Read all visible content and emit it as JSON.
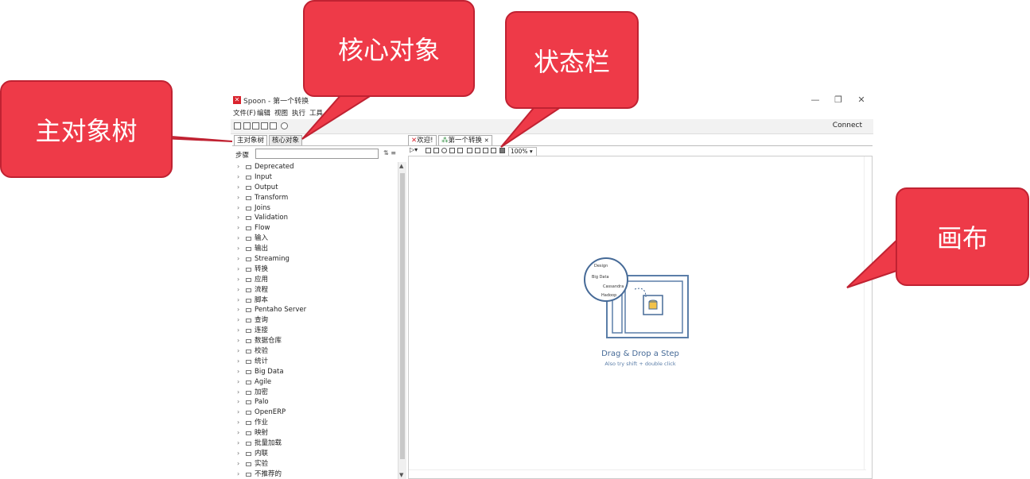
{
  "window": {
    "title": "Spoon - 第一个转换",
    "logo": "✕",
    "controls": [
      "—",
      "❐",
      "✕"
    ]
  },
  "menu": {
    "items": [
      "文件(F)",
      "编辑",
      "视图",
      "执行",
      "工具"
    ]
  },
  "toolbar": {
    "connect_label": "Connect"
  },
  "left_panel": {
    "tabs": [
      "主对象树",
      "核心对象"
    ],
    "search_label": "步骤",
    "search_value": "",
    "tree_items": [
      "Deprecated",
      "Input",
      "Output",
      "Transform",
      "Joins",
      "Validation",
      "Flow",
      "输入",
      "输出",
      "Streaming",
      "转换",
      "应用",
      "流程",
      "脚本",
      "Pentaho Server",
      "查询",
      "连接",
      "数据仓库",
      "校验",
      "统计",
      "Big Data",
      "Agile",
      "加密",
      "Palo",
      "OpenERP",
      "作业",
      "映射",
      "批量加载",
      "内联",
      "实验",
      "不推荐的"
    ]
  },
  "right_panel": {
    "tabs": [
      "欢迎!",
      "第一个转换"
    ],
    "zoom": "100%",
    "canvas_hint_title": "Drag & Drop a Step",
    "canvas_hint_sub": "Also try shift + double click",
    "illus_labels": [
      "Design",
      "Big Data",
      "Cassandra",
      "Hadoop"
    ]
  },
  "callouts": {
    "main_tree": "主对象树",
    "core_objects": "核心对象",
    "status_bar": "状态栏",
    "canvas": "画布"
  },
  "colors": {
    "callout_fill": "#ee3a48",
    "callout_border": "#c02232",
    "hint_text": "#466a97"
  }
}
